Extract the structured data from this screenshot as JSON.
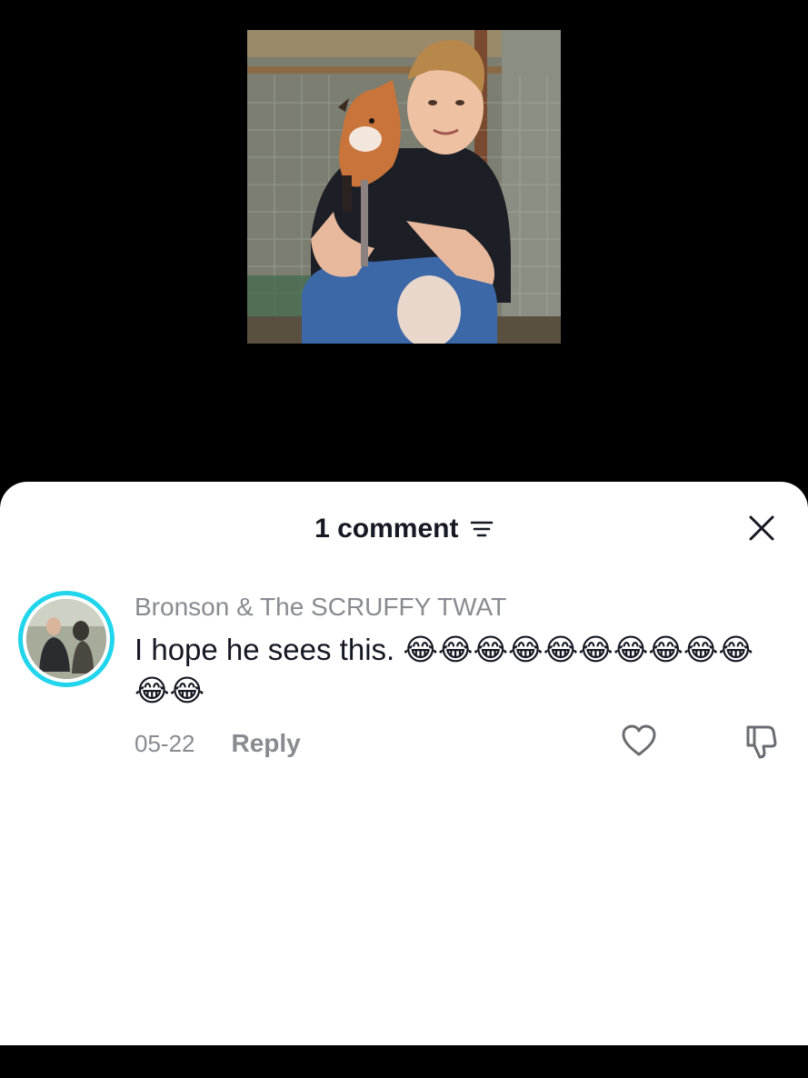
{
  "video": {
    "thumbnail_icon": "man-holding-fox-cub-photo"
  },
  "sheet": {
    "title": "1 comment",
    "sort_icon": "sort-lines-icon",
    "close_icon": "close-icon"
  },
  "comments": [
    {
      "username": "Bronson & The SCRUFFY TWAT",
      "text": "I hope he sees this.",
      "emojis": "😂😂😂😂😂😂😂😂😂😂😂😂",
      "date": "05-22",
      "reply_label": "Reply",
      "like_icon": "heart-outline-icon",
      "dislike_icon": "thumbs-down-outline-icon"
    }
  ],
  "colors": {
    "accent_ring": "#20d5ec",
    "title_text": "#161823",
    "muted_text": "#8a8b91"
  }
}
